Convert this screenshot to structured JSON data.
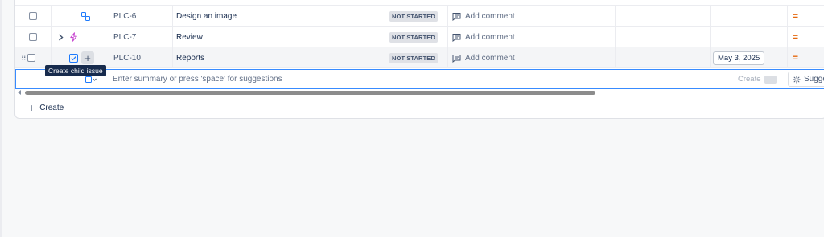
{
  "rows": [
    {
      "key": "PLC-6",
      "summary": "Design an image",
      "status": "NOT STARTED",
      "comment": "Add comment",
      "due": "",
      "icon": "subtask-icon"
    },
    {
      "key": "PLC-7",
      "summary": "Review",
      "status": "NOT STARTED",
      "comment": "Add comment",
      "due": "",
      "icon": "epic-icon"
    },
    {
      "key": "PLC-10",
      "summary": "Reports",
      "status": "NOT STARTED",
      "comment": "Add comment",
      "due": "May 3, 2025",
      "icon": "task-icon"
    }
  ],
  "tooltip": "Create child issue",
  "inline_create": {
    "placeholder": "Enter summary or press 'space' for suggestions",
    "create_label": "Create",
    "suggest_label": "Sugge"
  },
  "footer": {
    "create_label": "Create"
  },
  "colors": {
    "priority": "#e56910",
    "focus": "#388bff",
    "epic": "#c94bd1",
    "task": "#1d7afc"
  }
}
